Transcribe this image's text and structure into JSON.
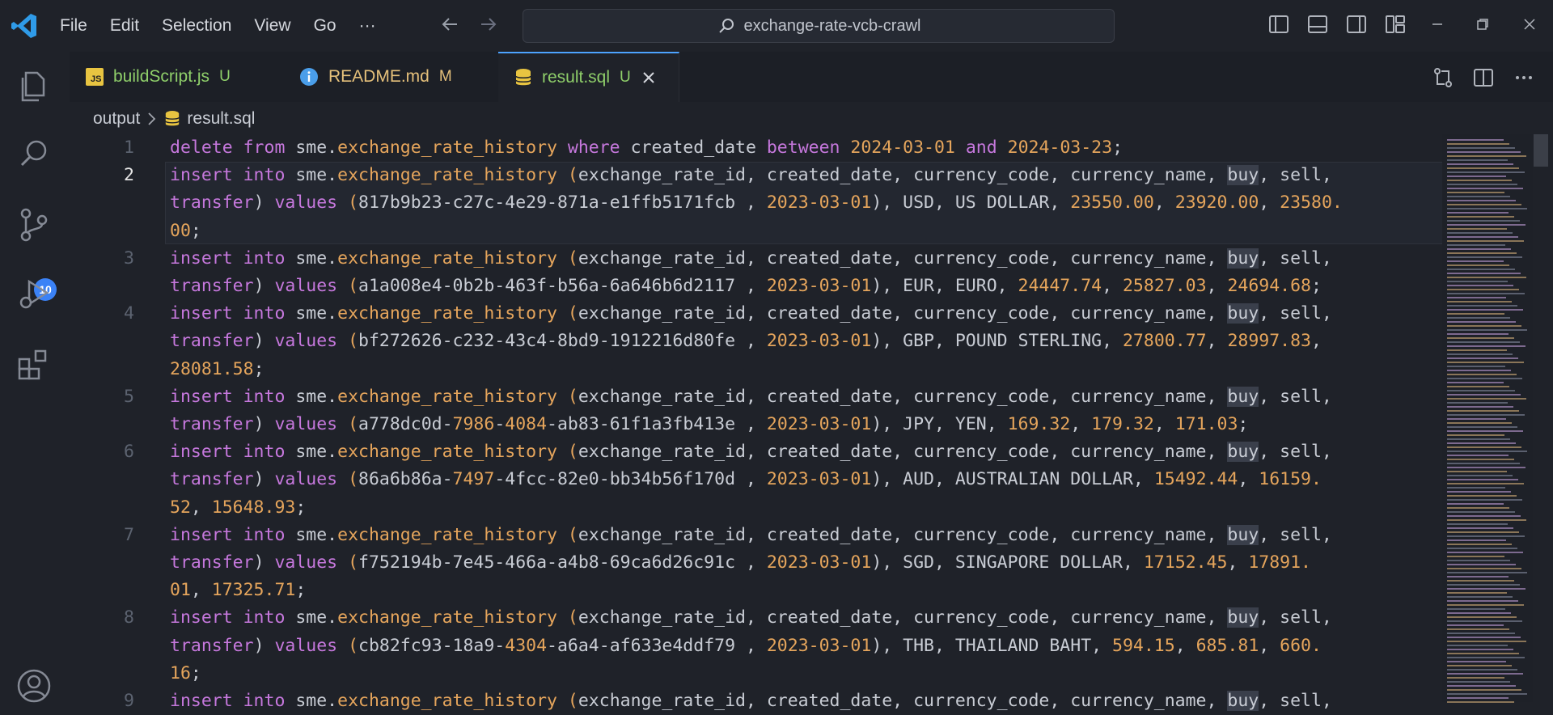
{
  "title_bar": {
    "menu": [
      "File",
      "Edit",
      "Selection",
      "View",
      "Go",
      "···"
    ],
    "search_label": "exchange-rate-vcb-crawl"
  },
  "activity_bar": {
    "items": [
      "explorer-icon",
      "search-icon",
      "source-control-icon",
      "run-debug-icon",
      "extensions-icon",
      "account-icon"
    ],
    "source_control_badge": "10"
  },
  "tabs": [
    {
      "name": "buildScript.js",
      "status": "U",
      "icon": "js-file-icon",
      "color": "#8fcf6a"
    },
    {
      "name": "README.md",
      "status": "M",
      "icon": "info-icon",
      "color": "#e5c07b"
    },
    {
      "name": "result.sql",
      "status": "U",
      "icon": "database-icon",
      "color": "#8fcf6a",
      "active": true
    }
  ],
  "breadcrumb": {
    "folder": "output",
    "file": "result.sql"
  },
  "editor": {
    "line_numbers": [
      "1",
      "2",
      "",
      "",
      "3",
      "",
      "4",
      "",
      "",
      "5",
      "",
      "6",
      "",
      "",
      "7",
      "",
      "",
      "8",
      "",
      "",
      "9"
    ],
    "current_line": "2",
    "insert_prefix": "insert into sme.exchange_rate_history (exchange_rate_id, created_date, currency_code, currency_name, buy, sell,",
    "lines": [
      {
        "type": "delete",
        "text": "delete from sme.exchange_rate_history where created_date between 2024-03-01 and 2024-03-23;"
      },
      {
        "id": "817b9b23-c27c-4e29-871a-e1ffb5171fcb",
        "date": "2023-03-01",
        "code": "USD",
        "name": "US DOLLAR",
        "buy": "23550.00",
        "sell": "23920.00",
        "transfer_a": "23580.",
        "transfer_b": "00",
        "wrap": "last"
      },
      {
        "id": "a1a008e4-0b2b-463f-b56a-6a646b6d2117",
        "date": "2023-03-01",
        "code": "EUR",
        "name": "EURO",
        "buy": "24447.74",
        "sell": "25827.03",
        "transfer_a": "24694.68",
        "wrap": "none"
      },
      {
        "id": "bf272626-c232-43c4-8bd9-1912216d80fe",
        "date": "2023-03-01",
        "code": "GBP",
        "name": "POUND STERLING",
        "buy": "27800.77",
        "sell": "28997.83",
        "transfer_a": "28081.58",
        "wrap": "full"
      },
      {
        "id": "a778dc0d-7986-4084-ab83-61f1a3fb413e",
        "date": "2023-03-01",
        "code": "JPY",
        "name": "YEN",
        "buy": "169.32",
        "sell": "179.32",
        "transfer_a": "171.03",
        "wrap": "none"
      },
      {
        "id": "86a6b86a-7497-4fcc-82e0-bb34b56f170d",
        "date": "2023-03-01",
        "code": "AUD",
        "name": "AUSTRALIAN DOLLAR",
        "buy": "15492.44",
        "sell_a": "16159.",
        "sell_b": "52",
        "transfer_a": "15648.93",
        "wrap": "sell"
      },
      {
        "id": "f752194b-7e45-466a-a4b8-69ca6d26c91c",
        "date": "2023-03-01",
        "code": "SGD",
        "name": "SINGAPORE DOLLAR",
        "buy": "17152.45",
        "sell_a": "17891.",
        "sell_b": "01",
        "transfer_a": "17325.71",
        "wrap": "sell"
      },
      {
        "id": "cb82fc93-18a9-4304-a6a4-af633e4ddf79",
        "date": "2023-03-01",
        "code": "THB",
        "name": "THAILAND BAHT",
        "buy": "594.15",
        "sell": "685.81",
        "transfer_a": "660.",
        "transfer_b": "16",
        "wrap": "last"
      }
    ],
    "partial_last": "insert into sme.exchange_rate_history (exchange_rate_id, created_date, currency_name, buy, sell,"
  },
  "colors": {
    "keyword": "#c678dd",
    "object": "#e5a55c",
    "number": "#e5a55c",
    "text": "#c8ccd4",
    "accent": "#4da3ff"
  }
}
